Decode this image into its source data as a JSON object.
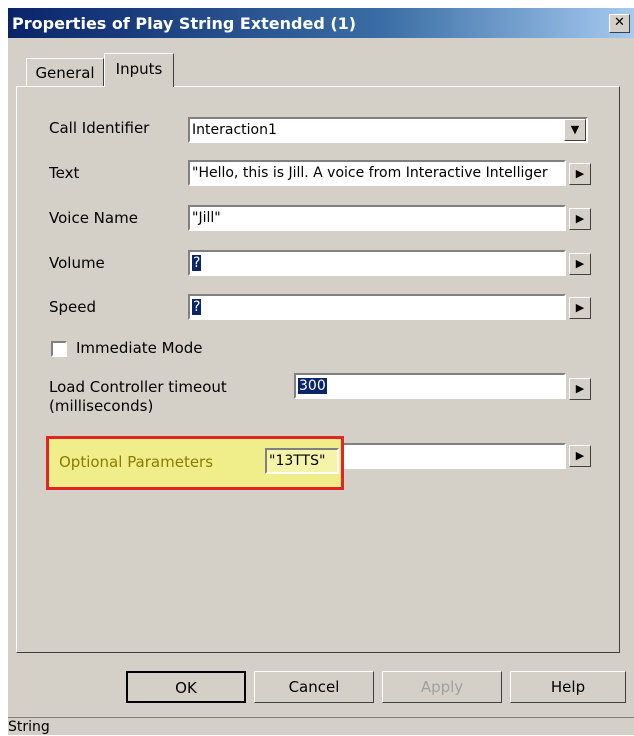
{
  "window": {
    "title": "Properties of Play String Extended (1)",
    "close_glyph": "✕"
  },
  "tabs": [
    {
      "label": "General"
    },
    {
      "label": "Inputs"
    }
  ],
  "fields": {
    "call_identifier": {
      "label": "Call Identifier",
      "value": "Interaction1"
    },
    "text": {
      "label": "Text",
      "value": "\"Hello, this is Jill. A voice from Interactive Intelliger"
    },
    "voice_name": {
      "label": "Voice Name",
      "value": "\"Jill\""
    },
    "volume": {
      "label": "Volume",
      "value": "?"
    },
    "speed": {
      "label": "Speed",
      "value": "?"
    },
    "immediate_mode": {
      "label": "Immediate Mode",
      "checked": false
    },
    "load_controller_timeout": {
      "label_line1": "Load Controller timeout",
      "label_line2": "(milliseconds)",
      "value": "300"
    },
    "optional_parameters": {
      "label": "Optional Parameters",
      "value": "\"13TTS\""
    }
  },
  "buttons": {
    "ok": "OK",
    "cancel": "Cancel",
    "apply": "Apply",
    "help": "Help"
  },
  "status": {
    "text": "String"
  },
  "icons": {
    "dropdown": "▼",
    "arrow": "▶"
  },
  "colors": {
    "highlight_border": "#e32424",
    "highlight_fill": "#f0ee8a",
    "selection": "#0a246a"
  }
}
